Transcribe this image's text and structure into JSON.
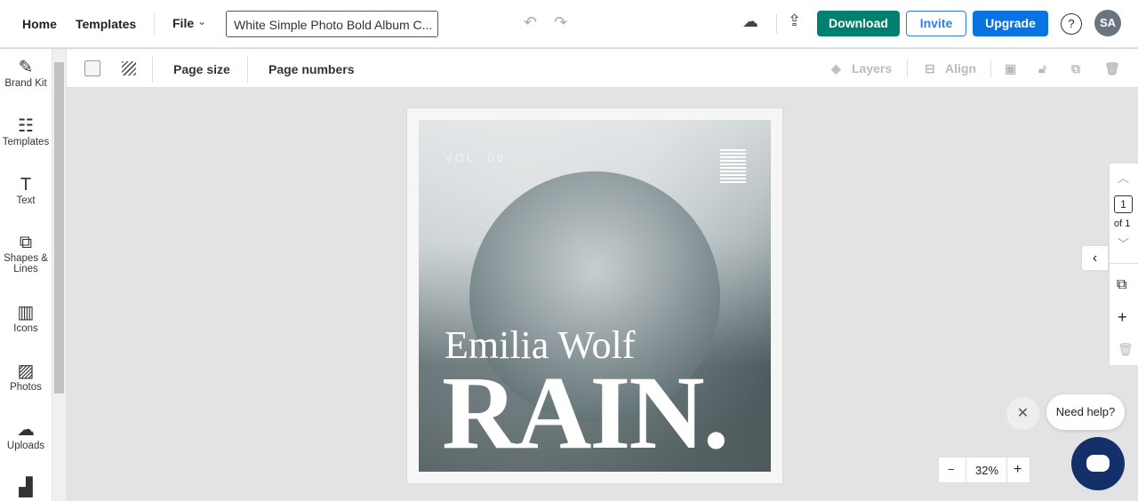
{
  "topbar": {
    "home": "Home",
    "templates": "Templates",
    "file": "File",
    "doc_title": "White Simple Photo Bold Album C...",
    "download": "Download",
    "invite": "Invite",
    "upgrade": "Upgrade",
    "help": "?",
    "avatar": "SA"
  },
  "colors": {
    "download": "#00806e",
    "upgrade": "#0a73e3",
    "invite_border": "#2f7fe0",
    "avatar": "#6c7480"
  },
  "toolbar": {
    "page_size": "Page size",
    "page_numbers": "Page numbers",
    "layers": "Layers",
    "align": "Align"
  },
  "sidebar": {
    "items": [
      {
        "label": "Brand Kit",
        "icon": "magic-wand-icon"
      },
      {
        "label": "Templates",
        "icon": "templates-icon"
      },
      {
        "label": "Text",
        "icon": "text-icon"
      },
      {
        "label": "Shapes & Lines",
        "icon": "shapes-icon"
      },
      {
        "label": "Icons",
        "icon": "briefcase-icon"
      },
      {
        "label": "Photos",
        "icon": "image-icon"
      },
      {
        "label": "Uploads",
        "icon": "upload-cloud-icon"
      }
    ]
  },
  "canvas": {
    "vol": "VOL. 06",
    "artist": "Emilia Wolf",
    "title": "RAIN."
  },
  "pager": {
    "current": "1",
    "of": "of 1"
  },
  "zoom": {
    "level": "32%",
    "minus": "−",
    "plus": "+"
  },
  "help_chat": {
    "label": "Need help?"
  }
}
